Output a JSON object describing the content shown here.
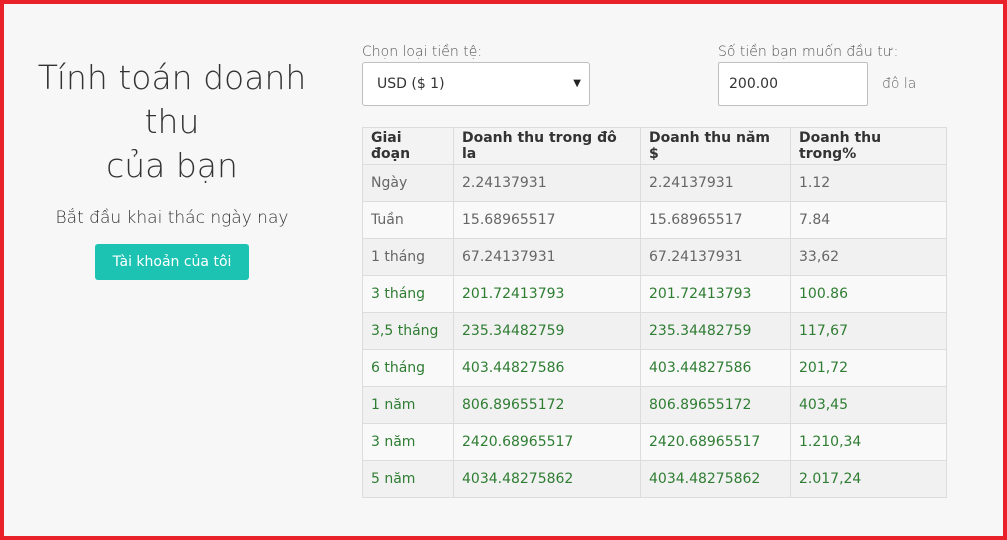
{
  "hero": {
    "title_line1": "Tính toán doanh thu",
    "title_line2": "của bạn",
    "subtitle": "Bắt đầu khai thác ngày nay",
    "account_button": "Tài khoản của tôi"
  },
  "form": {
    "currency_label": "Chọn loại tiền tệ:",
    "currency_value": "USD ($ 1)",
    "amount_label": "Số tiền bạn muốn đầu tư:",
    "amount_value": "200.00",
    "amount_unit": "đô la"
  },
  "table": {
    "headers": [
      "Giai đoạn",
      "Doanh thu trong đô la",
      "Doanh thu năm $",
      "Doanh thu trong%"
    ],
    "rows": [
      [
        "Ngày",
        "2.24137931",
        "2.24137931",
        "1.12"
      ],
      [
        "Tuần",
        "15.68965517",
        "15.68965517",
        "7.84"
      ],
      [
        "1 tháng",
        "67.24137931",
        "67.24137931",
        "33,62"
      ],
      [
        "3 tháng",
        "201.72413793",
        "201.72413793",
        "100.86"
      ],
      [
        "3,5 tháng",
        "235.34482759",
        "235.34482759",
        "117,67"
      ],
      [
        "6 tháng",
        "403.44827586",
        "403.44827586",
        "201,72"
      ],
      [
        "1 năm",
        "806.89655172",
        "806.89655172",
        "403,45"
      ],
      [
        "3 năm",
        "2420.68965517",
        "2420.68965517",
        "1.210,34"
      ],
      [
        "5 năm",
        "4034.48275862",
        "4034.48275862",
        "2.017,24"
      ]
    ]
  },
  "colors": {
    "accent": "#1cc3b2",
    "frame": "#e8212b",
    "gain": "#2e7d32"
  }
}
